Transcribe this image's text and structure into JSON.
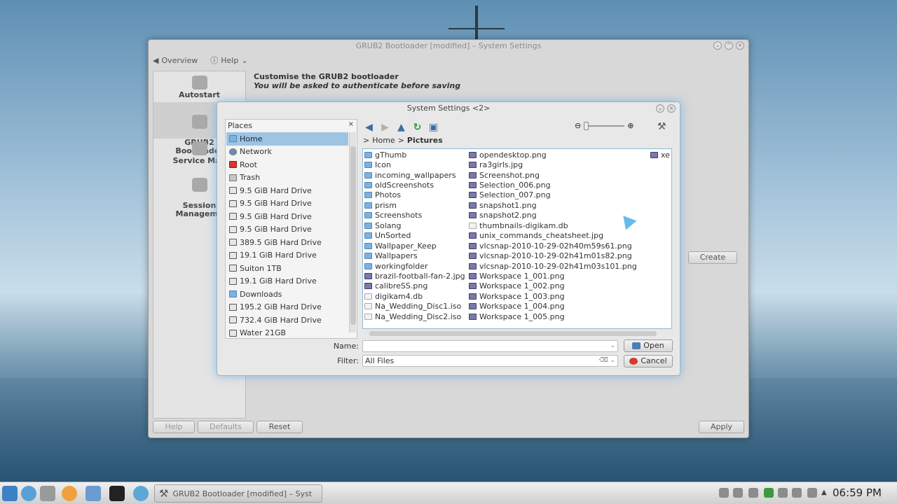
{
  "main_window": {
    "title": "GRUB2 Bootloader [modified] – System Settings",
    "toolbar": {
      "overview": "Overview",
      "help": "Help"
    },
    "sidebar": [
      {
        "label": "Autostart",
        "icon": "gear-icon"
      },
      {
        "label": "GRUB2\nBootloader",
        "icon": "grub-icon"
      },
      {
        "label": "Service Man",
        "icon": "flag-icon"
      },
      {
        "label": "Session\nManageme",
        "icon": "tools-icon"
      }
    ],
    "heading": "Customise the GRUB2 bootloader",
    "subheading": "You will be asked to authenticate before saving",
    "create_label": "Create",
    "buttons": {
      "help": "Help",
      "defaults": "Defaults",
      "reset": "Reset",
      "apply": "Apply"
    }
  },
  "dialog": {
    "title": "System Settings <2>",
    "places_title": "Places",
    "places": [
      {
        "label": "Home",
        "icon": "folder",
        "selected": true
      },
      {
        "label": "Network",
        "icon": "globe"
      },
      {
        "label": "Root",
        "icon": "red"
      },
      {
        "label": "Trash",
        "icon": "trash"
      },
      {
        "label": "9.5 GiB Hard Drive",
        "icon": "drive"
      },
      {
        "label": "9.5 GiB Hard Drive",
        "icon": "drive"
      },
      {
        "label": "9.5 GiB Hard Drive",
        "icon": "drive"
      },
      {
        "label": "9.5 GiB Hard Drive",
        "icon": "drive"
      },
      {
        "label": "389.5 GiB Hard Drive",
        "icon": "drive"
      },
      {
        "label": "19.1 GiB Hard Drive",
        "icon": "drive"
      },
      {
        "label": "Suiton 1TB",
        "icon": "drive"
      },
      {
        "label": "19.1 GiB Hard Drive",
        "icon": "drive"
      },
      {
        "label": "Downloads",
        "icon": "folder"
      },
      {
        "label": "195.2 GiB Hard Drive",
        "icon": "drive"
      },
      {
        "label": "732.4 GiB Hard Drive",
        "icon": "drive"
      },
      {
        "label": "Water 21GB",
        "icon": "drive"
      }
    ],
    "breadcrumb": {
      "root": "Home",
      "separator": ">",
      "current": "Pictures"
    },
    "files_col1": [
      {
        "name": "gThumb",
        "type": "folder"
      },
      {
        "name": "Icon",
        "type": "folder"
      },
      {
        "name": "incoming_wallpapers",
        "type": "folder"
      },
      {
        "name": "oldScreenshots",
        "type": "folder"
      },
      {
        "name": "Photos",
        "type": "folder"
      },
      {
        "name": "prism",
        "type": "folder"
      },
      {
        "name": "Screenshots",
        "type": "folder"
      },
      {
        "name": "Solang",
        "type": "folder"
      },
      {
        "name": "UnSorted",
        "type": "folder"
      },
      {
        "name": "Wallpaper_Keep",
        "type": "folder"
      },
      {
        "name": "Wallpapers",
        "type": "folder"
      },
      {
        "name": "workingfolder",
        "type": "folder"
      },
      {
        "name": "brazil-football-fan-2.jpg",
        "type": "image"
      },
      {
        "name": "calibreSS.png",
        "type": "image"
      },
      {
        "name": "digikam4.db",
        "type": "generic"
      },
      {
        "name": "Na_Wedding_Disc1.iso",
        "type": "generic"
      },
      {
        "name": "Na_Wedding_Disc2.iso",
        "type": "generic"
      }
    ],
    "files_col2": [
      {
        "name": "opendesktop.png",
        "type": "image"
      },
      {
        "name": "ra3girls.jpg",
        "type": "image"
      },
      {
        "name": "Screenshot.png",
        "type": "image"
      },
      {
        "name": "Selection_006.png",
        "type": "image"
      },
      {
        "name": "Selection_007.png",
        "type": "image"
      },
      {
        "name": "snapshot1.png",
        "type": "image"
      },
      {
        "name": "snapshot2.png",
        "type": "image"
      },
      {
        "name": "thumbnails-digikam.db",
        "type": "generic"
      },
      {
        "name": "unix_commands_cheatsheet.jpg",
        "type": "image"
      },
      {
        "name": "vlcsnap-2010-10-29-02h40m59s61.png",
        "type": "image"
      },
      {
        "name": "vlcsnap-2010-10-29-02h41m01s82.png",
        "type": "image"
      },
      {
        "name": "vlcsnap-2010-10-29-02h41m03s101.png",
        "type": "image"
      },
      {
        "name": "Workspace 1_001.png",
        "type": "image"
      },
      {
        "name": "Workspace 1_002.png",
        "type": "image"
      },
      {
        "name": "Workspace 1_003.png",
        "type": "image"
      },
      {
        "name": "Workspace 1_004.png",
        "type": "image"
      },
      {
        "name": "Workspace 1_005.png",
        "type": "image"
      }
    ],
    "files_col3": [
      {
        "name": "xe",
        "type": "image"
      }
    ],
    "name_label": "Name:",
    "name_value": "",
    "filter_label": "Filter:",
    "filter_value": "All Files",
    "open_label": "Open",
    "cancel_label": "Cancel"
  },
  "taskbar": {
    "task_label": "GRUB2 Bootloader [modified] – Syst",
    "clock": "06:59 PM"
  }
}
